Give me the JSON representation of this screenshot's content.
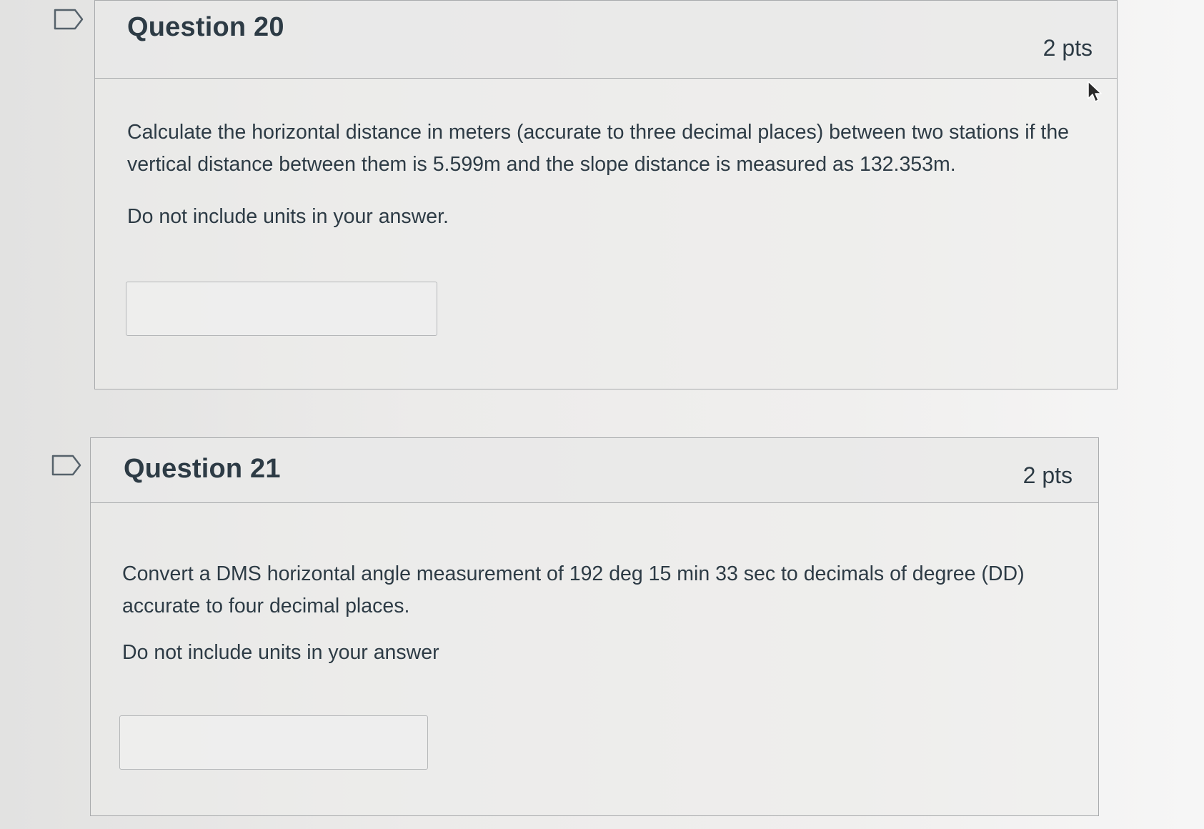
{
  "questions": [
    {
      "title": "Question 20",
      "points": "2 pts",
      "text": "Calculate the horizontal distance in meters (accurate to three decimal places) between two stations if the vertical distance between them is 5.599m and the slope distance is measured as 132.353m.",
      "instruction": "Do not include units in your answer.",
      "answer_value": ""
    },
    {
      "title": "Question 21",
      "points": "2 pts",
      "text": "Convert a DMS horizontal angle measurement of 192 deg 15 min 33 sec to decimals of degree (DD) accurate to four decimal places.",
      "instruction": "Do not include units in your answer",
      "answer_value": ""
    }
  ],
  "icons": {
    "flag": "flag-question-icon",
    "cursor": "mouse-pointer-icon"
  },
  "colors": {
    "text": "#2d3b45",
    "border": "#a9abad"
  }
}
